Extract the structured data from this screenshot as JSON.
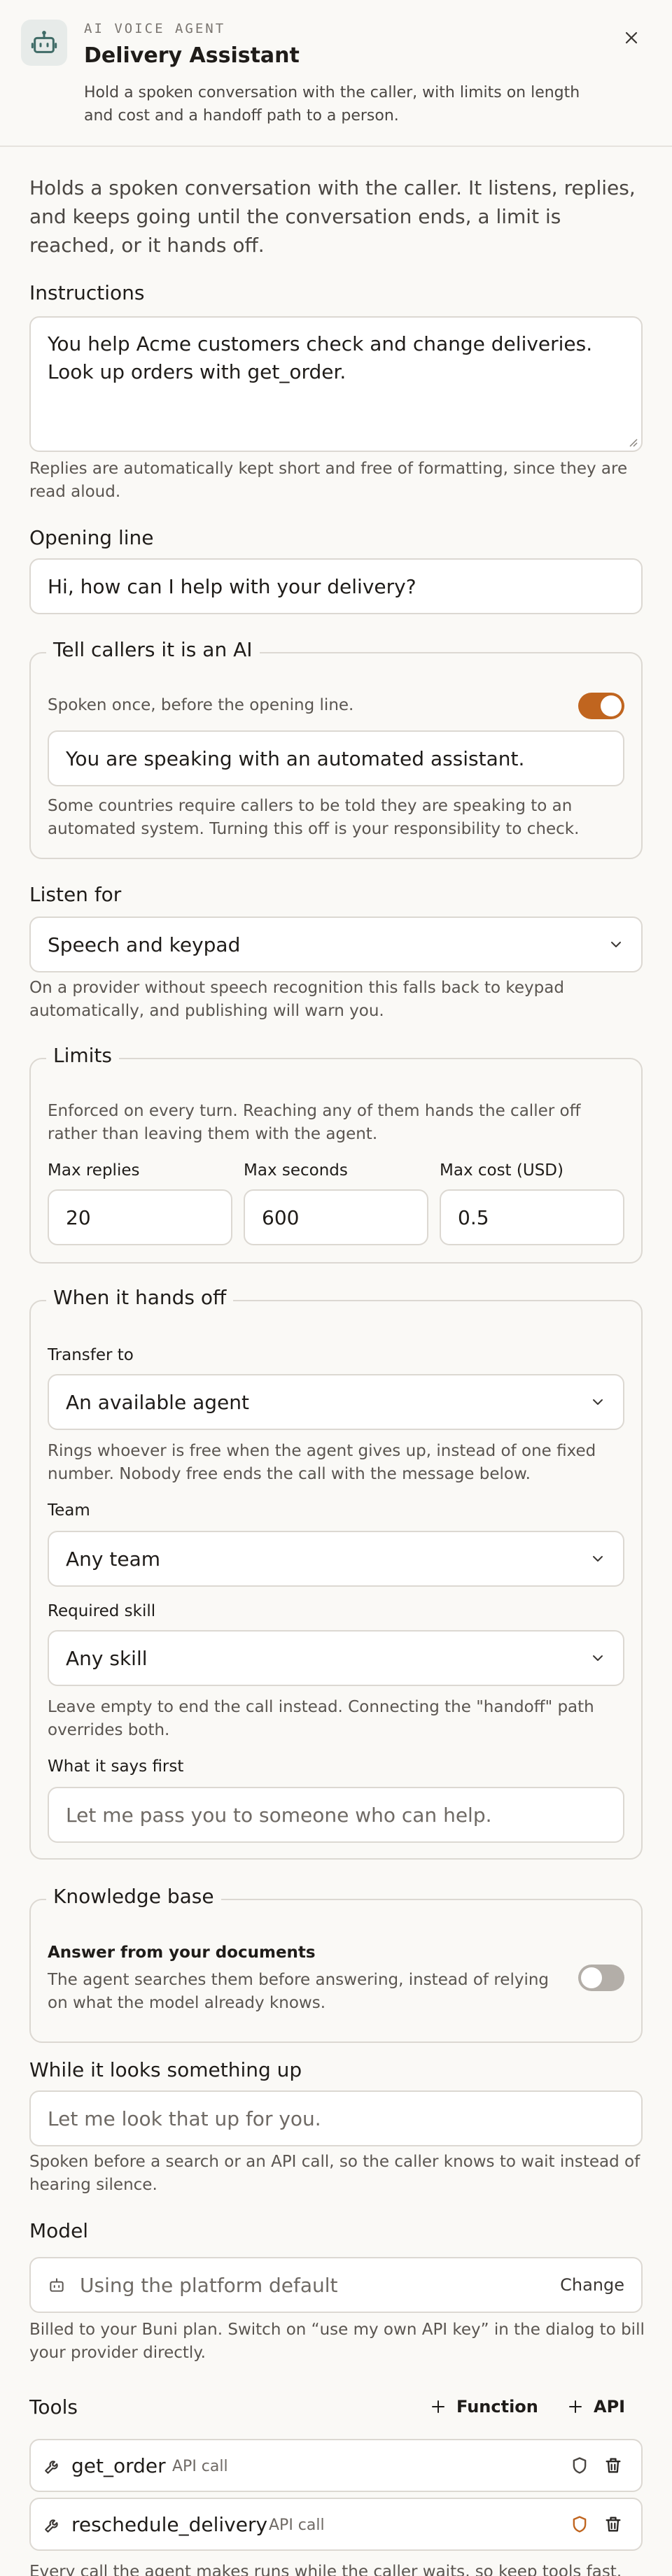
{
  "header": {
    "eyebrow": "AI VOICE AGENT",
    "title": "Delivery Assistant",
    "description": "Hold a spoken conversation with the caller, with limits on length and cost and a handoff path to a person."
  },
  "intro": "Holds a spoken conversation with the caller. It listens, replies, and keeps going until the conversation ends, a limit is reached, or it hands off.",
  "instructions": {
    "label": "Instructions",
    "value": "You help Acme customers check and change deliveries. Look up orders with get_order.",
    "help": "Replies are automatically kept short and free of formatting, since they are read aloud."
  },
  "opening_line": {
    "label": "Opening line",
    "value": "Hi, how can I help with your delivery?"
  },
  "ai_disclosure": {
    "legend": "Tell callers it is an AI",
    "toggle_label": "Spoken once, before the opening line.",
    "toggle_on": true,
    "value": "You are speaking with an automated assistant.",
    "help": "Some countries require callers to be told they are speaking to an automated system. Turning this off is your responsibility to check."
  },
  "listen_for": {
    "label": "Listen for",
    "selected": "Speech and keypad",
    "help": "On a provider without speech recognition this falls back to keypad automatically, and publishing will warn you."
  },
  "limits": {
    "legend": "Limits",
    "help": "Enforced on every turn. Reaching any of them hands the caller off rather than leaving them with the agent.",
    "max_replies_label": "Max replies",
    "max_replies": "20",
    "max_seconds_label": "Max seconds",
    "max_seconds": "600",
    "max_cost_label": "Max cost (USD)",
    "max_cost": "0.5"
  },
  "handoff": {
    "legend": "When it hands off",
    "transfer_label": "Transfer to",
    "transfer_selected": "An available agent",
    "transfer_help": "Rings whoever is free when the agent gives up, instead of one fixed number. Nobody free ends the call with the message below.",
    "team_label": "Team",
    "team_selected": "Any team",
    "skill_label": "Required skill",
    "skill_selected": "Any skill",
    "skill_help": "Leave empty to end the call instead. Connecting the \"handoff\" path overrides both.",
    "says_first_label": "What it says first",
    "says_first_placeholder": "Let me pass you to someone who can help."
  },
  "knowledge": {
    "legend": "Knowledge base",
    "title": "Answer from your documents",
    "help": "The agent searches them before answering, instead of relying on what the model already knows.",
    "toggle_on": false
  },
  "lookup": {
    "label": "While it looks something up",
    "placeholder": "Let me look that up for you.",
    "help": "Spoken before a search or an API call, so the caller knows to wait instead of hearing silence."
  },
  "model": {
    "label": "Model",
    "value": "Using the platform default",
    "change_label": "Change",
    "help": "Billed to your Buni plan. Switch on “use my own API key” in the dialog to bill your provider directly."
  },
  "tools": {
    "label": "Tools",
    "add_function": "Function",
    "add_api": "API",
    "items": [
      {
        "name": "get_order",
        "type": "API call",
        "shield_color": "#4a4642"
      },
      {
        "name": "reschedule_delivery",
        "type": "API call",
        "shield_color": "#c0651f"
      }
    ],
    "footer": "Every call the agent makes runs while the caller waits, so keep tools fast."
  },
  "colors": {
    "accent": "#c0651f",
    "background": "#faf9f6",
    "border": "#dcd8d2"
  }
}
